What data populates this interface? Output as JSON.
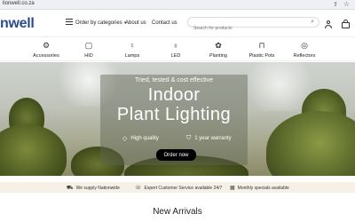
{
  "browser": {
    "url": "lionwell.co.za"
  },
  "header": {
    "logo": "nwell",
    "nav": {
      "categories": "Order by categories",
      "about": "About us",
      "contact": "Contact us"
    },
    "search": {
      "placeholder": "Search for products"
    }
  },
  "categories": [
    {
      "label": "Accessories",
      "icon": "accessories-icon"
    },
    {
      "label": "HID",
      "icon": "hid-icon"
    },
    {
      "label": "Lamps",
      "icon": "lamp-icon"
    },
    {
      "label": "LED",
      "icon": "led-icon"
    },
    {
      "label": "Planting",
      "icon": "planting-icon"
    },
    {
      "label": "Plastic Pots",
      "icon": "pot-icon"
    },
    {
      "label": "Reflectors",
      "icon": "reflector-icon"
    }
  ],
  "hero": {
    "tagline": "Tried, tested & cost effective",
    "title_line1": "Indoor",
    "title_line2": "Plant Lighting",
    "feature1": "High quality",
    "feature2": "1 year warranty",
    "cta": "Order now"
  },
  "info_strip": [
    {
      "text": "We supply Nationwide",
      "icon": "truck-icon"
    },
    {
      "text": "Expert Customer Service available 24/7",
      "icon": "support-icon"
    },
    {
      "text": "Monthly specials available",
      "icon": "calendar-icon"
    }
  ],
  "sections": {
    "new_arrivals": "New Arrivals"
  }
}
